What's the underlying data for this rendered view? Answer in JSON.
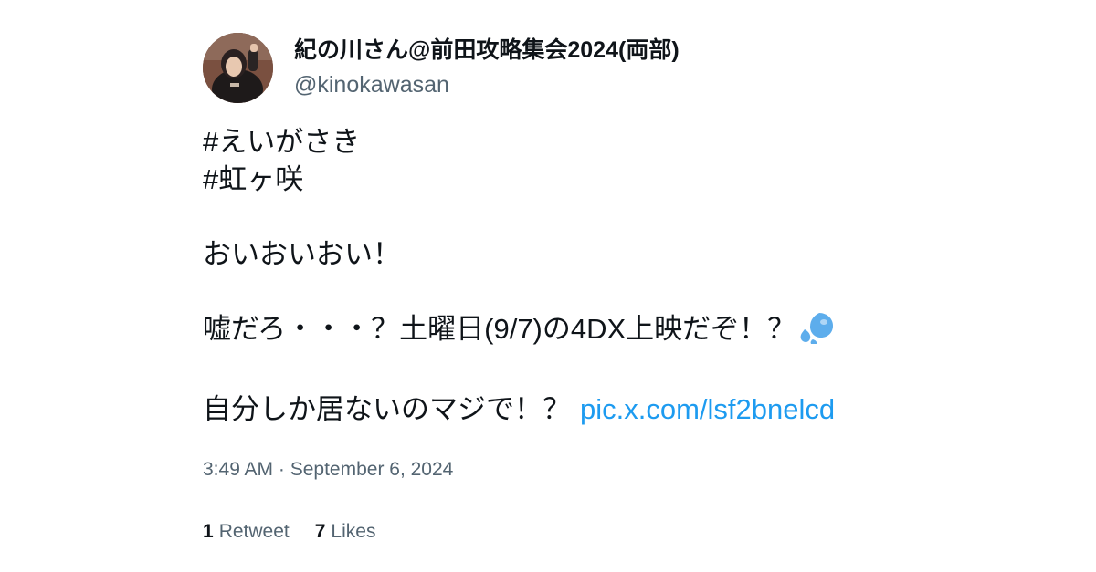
{
  "author": {
    "display_name": "紀の川さん@前田攻略集会2024(両部)",
    "handle": "@kinokawasan"
  },
  "tweet": {
    "lines": {
      "l1": "#えいがさき",
      "l2": "#虹ヶ咲",
      "l3": "おいおいおい！",
      "l4": "嘘だろ・・・？土曜日(9/7)の4DX上映だぞ！？",
      "l5": "自分しか居ないのマジで！？"
    },
    "link": "pic.x.com/lsf2bnelcd",
    "emoji": "sweat-droplets-icon"
  },
  "timestamp": "3:49 AM · September 6, 2024",
  "stats": {
    "retweets_count": "1",
    "retweets_label": "Retweet",
    "likes_count": "7",
    "likes_label": "Likes"
  },
  "colors": {
    "link": "#1d9bf0",
    "secondary_text": "#536471",
    "primary_text": "#0f1419"
  }
}
